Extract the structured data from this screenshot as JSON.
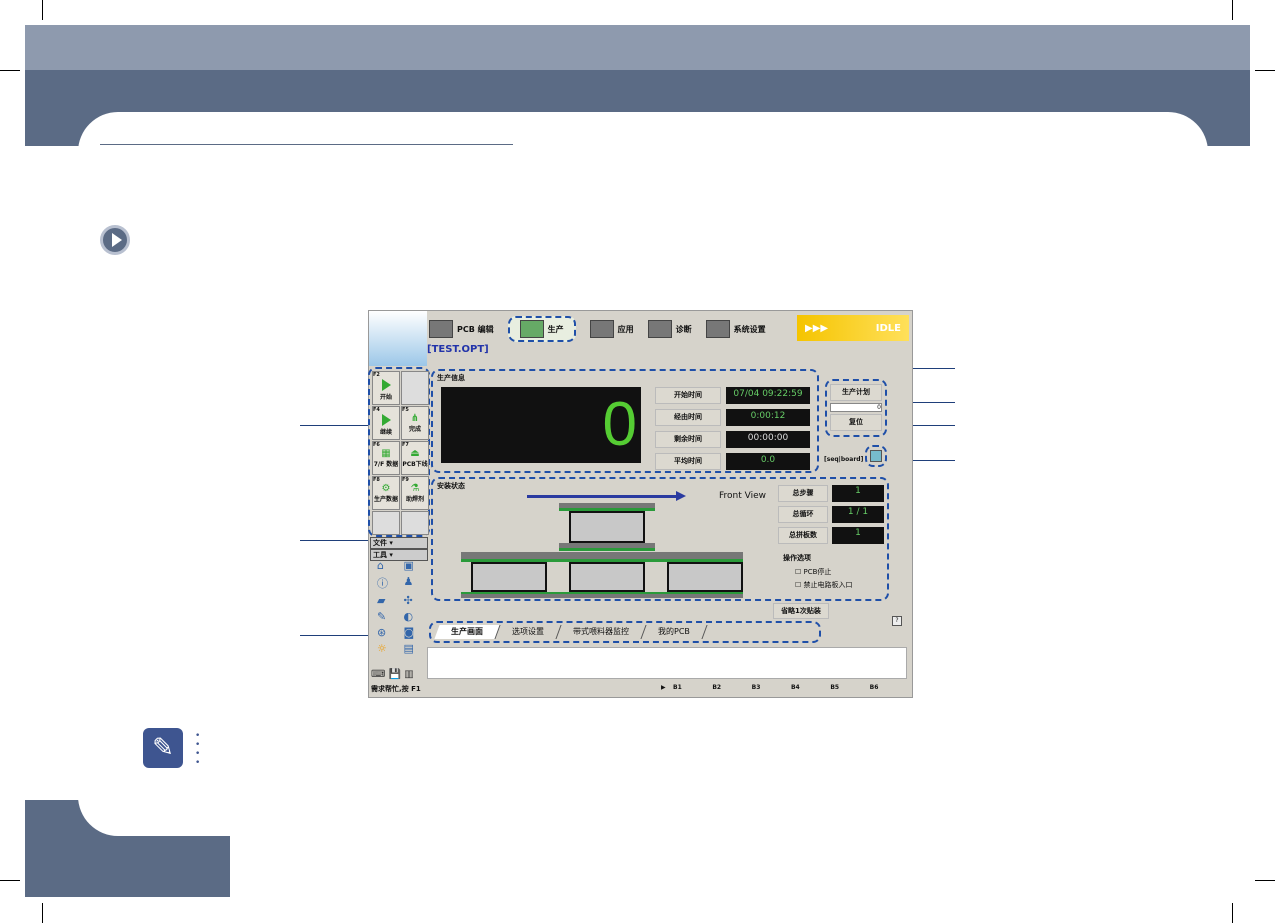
{
  "app": {
    "toolbar": [
      {
        "label": "PCB 编辑",
        "icon": "pcb-edit-icon"
      },
      {
        "label": "生产",
        "icon": "production-icon"
      },
      {
        "label": "应用",
        "icon": "application-icon"
      },
      {
        "label": "诊断",
        "icon": "diagnosis-icon"
      },
      {
        "label": "系统设置",
        "icon": "system-settings-icon"
      }
    ],
    "status": "IDLE",
    "status_arrows": "▶▶▶",
    "file": "[TEST.OPT]",
    "fkeys": [
      {
        "key": "F2",
        "label": "开始"
      },
      {
        "key": "",
        "label": ""
      },
      {
        "key": "F4",
        "label": "继续"
      },
      {
        "key": "F5",
        "label": "完成"
      },
      {
        "key": "F6",
        "label": "7/F 数据"
      },
      {
        "key": "F7",
        "label": "PCB下线"
      },
      {
        "key": "F8",
        "label": "生产数据"
      },
      {
        "key": "F9",
        "label": "助焊剂"
      }
    ],
    "menus": [
      "文件",
      "工具"
    ],
    "info": {
      "title": "生产信息",
      "count": "0",
      "rows": [
        {
          "label": "开始时间",
          "value": "07/04 09:22:59"
        },
        {
          "label": "经由时间",
          "value": "0:00:12"
        },
        {
          "label": "剩余时间",
          "value": "00:00:00"
        },
        {
          "label": "平均时间",
          "value": "0.0"
        }
      ]
    },
    "plan": {
      "title": "生产计划",
      "value": "0",
      "reset": "复位",
      "seq": "[seq|board]"
    },
    "state": {
      "title": "安装状态",
      "front_view": "Front View",
      "rows": [
        {
          "label": "总步骤",
          "value": "1"
        },
        {
          "label": "总循环",
          "value": "1 / 1"
        },
        {
          "label": "总拼板数",
          "value": "1"
        }
      ],
      "options_title": "操作选项",
      "options": [
        "PCB停止",
        "禁止电路板入口"
      ]
    },
    "skip_button": "省略1次贴装",
    "help": "?",
    "tabs": [
      "生产画面",
      "选项设置",
      "带式喂料器监控",
      "我的PCB"
    ],
    "statusbar": {
      "hint": "需求帮忙,按 F1",
      "slots": [
        "B1",
        "B2",
        "B3",
        "B4",
        "B5",
        "B6"
      ]
    }
  }
}
